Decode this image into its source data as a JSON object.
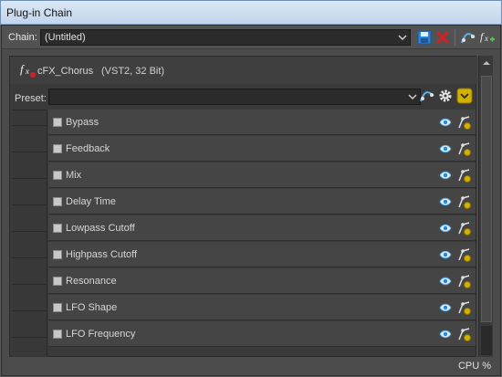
{
  "window": {
    "title": "Plug-in Chain"
  },
  "chain": {
    "label": "Chain:",
    "value": "(Untitled)"
  },
  "plugin": {
    "name": "cFX_Chorus",
    "info": "(VST2, 32 Bit)"
  },
  "preset": {
    "label": "Preset:",
    "value": ""
  },
  "parameters": [
    {
      "name": "Bypass"
    },
    {
      "name": "Feedback"
    },
    {
      "name": "Mix"
    },
    {
      "name": "Delay Time"
    },
    {
      "name": "Lowpass Cutoff"
    },
    {
      "name": "Highpass Cutoff"
    },
    {
      "name": "Resonance"
    },
    {
      "name": "LFO Shape"
    },
    {
      "name": "LFO Frequency"
    }
  ],
  "status": {
    "cpu_label": "CPU %"
  },
  "icons": {
    "save": "save-icon",
    "remove": "remove-icon",
    "envelope": "automation-envelope-icon",
    "add_fx": "add-fx-icon",
    "gear": "gear-icon",
    "menu": "chevron-down-menu-icon",
    "visibility": "eye-icon",
    "automation": "automation-icon"
  },
  "colors": {
    "accent_yellow": "#d4b000",
    "remove_red": "#d42020",
    "save_blue": "#2a84d8",
    "eye_blue": "#5ab0e8"
  }
}
